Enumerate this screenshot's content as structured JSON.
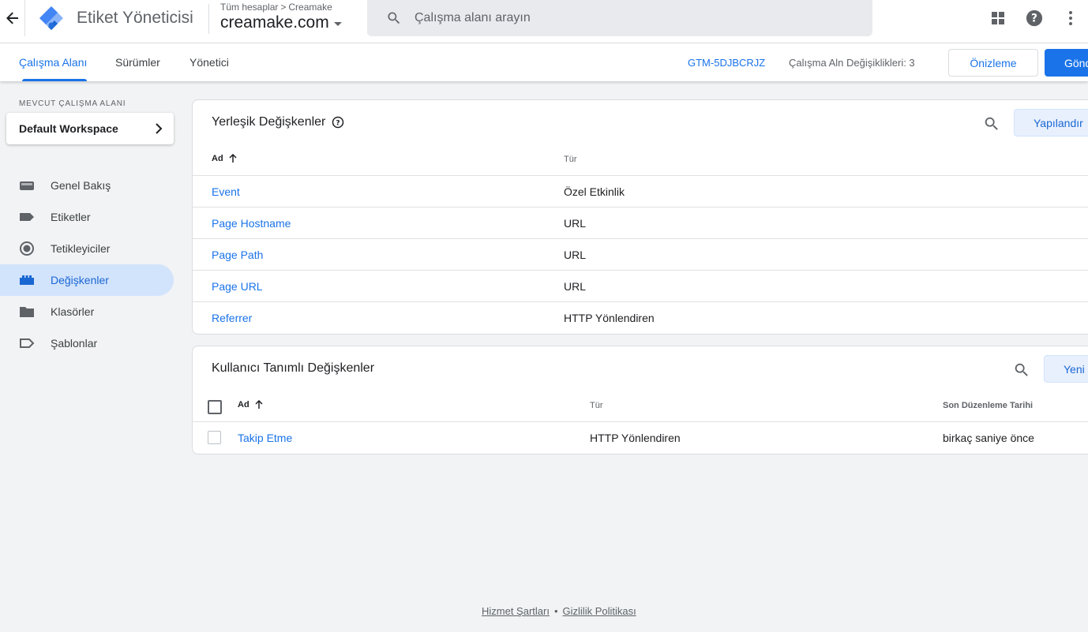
{
  "header": {
    "app_title": "Etiket Yöneticisi",
    "breadcrumb": {
      "all_accounts": "Tüm hesaplar",
      "separator": ">",
      "account": "Creamake"
    },
    "container": "creamake.com",
    "search_placeholder": "Çalışma alanı arayın"
  },
  "subnav": {
    "tabs": [
      {
        "label": "Çalışma Alanı",
        "active": true
      },
      {
        "label": "Sürümler",
        "active": false
      },
      {
        "label": "Yönetici",
        "active": false
      }
    ],
    "container_id": "GTM-5DJBCRJZ",
    "workspace_changes": "Çalışma Aln Değişiklikleri: 3",
    "preview_label": "Önizleme",
    "submit_label": "Gönd"
  },
  "sidebar": {
    "workspace_label": "MEVCUT ÇALIŞMA ALANI",
    "workspace_name": "Default Workspace",
    "items": [
      {
        "label": "Genel Bakış",
        "icon": "overview-icon",
        "active": false
      },
      {
        "label": "Etiketler",
        "icon": "tag-icon",
        "active": false
      },
      {
        "label": "Tetikleyiciler",
        "icon": "trigger-icon",
        "active": false
      },
      {
        "label": "Değişkenler",
        "icon": "variables-icon",
        "active": true
      },
      {
        "label": "Klasörler",
        "icon": "folder-icon",
        "active": false
      },
      {
        "label": "Şablonlar",
        "icon": "template-icon",
        "active": false
      }
    ]
  },
  "builtin": {
    "title": "Yerleşik Değişkenler",
    "configure_label": "Yapılandır",
    "col_name": "Ad",
    "col_type": "Tür",
    "rows": [
      {
        "name": "Event",
        "type": "Özel Etkinlik"
      },
      {
        "name": "Page Hostname",
        "type": "URL"
      },
      {
        "name": "Page Path",
        "type": "URL"
      },
      {
        "name": "Page URL",
        "type": "URL"
      },
      {
        "name": "Referrer",
        "type": "HTTP Yönlendiren"
      }
    ]
  },
  "user_defined": {
    "title": "Kullanıcı Tanımlı Değişkenler",
    "new_label": "Yeni",
    "col_name": "Ad",
    "col_type": "Tür",
    "col_modified": "Son Düzenleme Tarihi",
    "rows": [
      {
        "name": "Takip Etme",
        "type": "HTTP Yönlendiren",
        "modified": "birkaç saniye önce"
      }
    ]
  },
  "footer": {
    "terms": "Hizmet Şartları",
    "separator": "•",
    "privacy": "Gizlilik Politikası"
  },
  "colors": {
    "accent": "#1a73e8",
    "active_nav_bg": "#d2e3fc",
    "page_bg": "#f1f3f4"
  }
}
